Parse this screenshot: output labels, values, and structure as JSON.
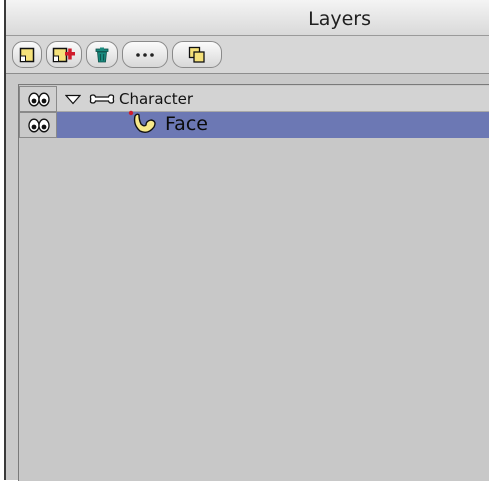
{
  "panel": {
    "title": "Layers"
  },
  "toolbar": {
    "buttons": [
      {
        "id": "new-layer",
        "icon": "new-layer-icon"
      },
      {
        "id": "new-layer-plus",
        "icon": "add-layer-icon"
      },
      {
        "id": "delete-layer",
        "icon": "trash-icon"
      },
      {
        "id": "more-options",
        "icon": "ellipsis-icon",
        "label": "···"
      },
      {
        "id": "duplicate-layer",
        "icon": "duplicate-icon"
      }
    ]
  },
  "layers": [
    {
      "name": "Character",
      "type": "bone",
      "expanded": true,
      "visible": true,
      "selected": false
    },
    {
      "name": "Face",
      "type": "vector",
      "visible": true,
      "selected": true
    }
  ],
  "colors": {
    "selection": "#6c78b4",
    "panel_bg": "#c9c9c9",
    "trash_icon": "#1a8a7e",
    "add_icon": "#d01c2c",
    "layer_icon_yellow": "#f7e98a"
  }
}
